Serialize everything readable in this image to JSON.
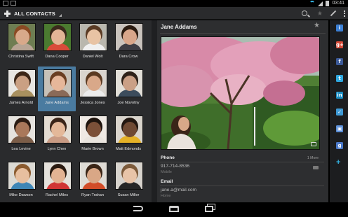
{
  "status_bar": {
    "time": "03:41"
  },
  "action_bar": {
    "title": "ALL CONTACTS"
  },
  "contacts": [
    {
      "name": "Christina Swift",
      "bg": "#6e7d52",
      "skin": "#d8a98a",
      "hair": "#8a4a23",
      "shirt": "#b7a494"
    },
    {
      "name": "Dana Cooper",
      "bg": "#4b7a30",
      "skin": "#e3b496",
      "hair": "#3b2a1c",
      "shirt": "#d94b3a"
    },
    {
      "name": "Daniel Wolt",
      "bg": "#b9b7ae",
      "skin": "#e8c3a4",
      "hair": "#5a3b24",
      "shirt": "#f0f0f0"
    },
    {
      "name": "Dara Crow",
      "bg": "#c9c3bd",
      "skin": "#d8a68a",
      "hair": "#2b1b10",
      "shirt": "#3d3d44"
    },
    {
      "name": "James Arnold",
      "bg": "#e8e6e2",
      "skin": "#caa083",
      "hair": "#3b2617",
      "shirt": "#a8905f"
    },
    {
      "name": "Jane Addams",
      "bg": "#c7c1b8",
      "skin": "#e6b79a",
      "hair": "#6a3e22",
      "shirt": "#8a6a58"
    },
    {
      "name": "Jessica Jones",
      "bg": "#d9d5cf",
      "skin": "#d9a889",
      "hair": "#5b3a22",
      "shirt": "#ececec"
    },
    {
      "name": "Joe Novotny",
      "bg": "#e2dfd8",
      "skin": "#caa086",
      "hair": "#2e2219",
      "shirt": "#3c4c5c"
    },
    {
      "name": "Lea Levine",
      "bg": "#e6e3de",
      "skin": "#a9785a",
      "hair": "#2a1b12",
      "shirt": "#7b5d48"
    },
    {
      "name": "Lynn Chen",
      "bg": "#e4dcd2",
      "skin": "#e4b899",
      "hair": "#3a2418",
      "shirt": "#c99b84"
    },
    {
      "name": "Marie Brown",
      "bg": "#efe9e4",
      "skin": "#7c5038",
      "hair": "#1f140e",
      "shirt": "#e9e4de"
    },
    {
      "name": "Matt Edmonds",
      "bg": "#d9d4cc",
      "skin": "#6f4a33",
      "hair": "#221710",
      "shirt": "#e5b227"
    },
    {
      "name": "Mike Dawson",
      "bg": "#dcdad4",
      "skin": "#e7bf9f",
      "hair": "#8a5a2e",
      "shirt": "#3e86b6"
    },
    {
      "name": "Rachel Miles",
      "bg": "#e4e1db",
      "skin": "#e3b393",
      "hair": "#2a1a10",
      "shirt": "#d03535"
    },
    {
      "name": "Ryan Trahan",
      "bg": "#dedbd5",
      "skin": "#d9a786",
      "hair": "#3a2516",
      "shirt": "#d14c28"
    },
    {
      "name": "Susan Miller",
      "bg": "#d7d3cd",
      "skin": "#e8c4a8",
      "hair": "#7c5a3a",
      "shirt": "#262626"
    }
  ],
  "selected_contact": "Jane Addams",
  "detail": {
    "name": "Jane Addams",
    "phone_label": "Phone",
    "more_label": "1 More",
    "phone_number": "917-714-8536",
    "phone_type": "Mobile",
    "email_label": "Email",
    "email_address": "jane.a@mail.com",
    "email_type": "Home"
  },
  "social_icons": [
    {
      "name": "info-icon",
      "glyph": "i",
      "color": "#3b7fd4"
    },
    {
      "name": "google-plus-icon",
      "glyph": "g+",
      "color": "#d34836"
    },
    {
      "name": "facebook-icon",
      "glyph": "f",
      "color": "#3b5998"
    },
    {
      "name": "twitter-icon",
      "glyph": "t",
      "color": "#2fa8e0"
    },
    {
      "name": "linkedin-icon",
      "glyph": "in",
      "color": "#1a8dc3"
    },
    {
      "name": "messenger-icon",
      "glyph": "✓",
      "color": "#3e9ad6"
    },
    {
      "name": "image-icon",
      "glyph": "▣",
      "color": "#5b8fd8"
    },
    {
      "name": "google-icon",
      "glyph": "g",
      "color": "#4a78c8"
    }
  ],
  "colors": {
    "accent": "#33b5e5",
    "selected": "#4a7ba0"
  }
}
